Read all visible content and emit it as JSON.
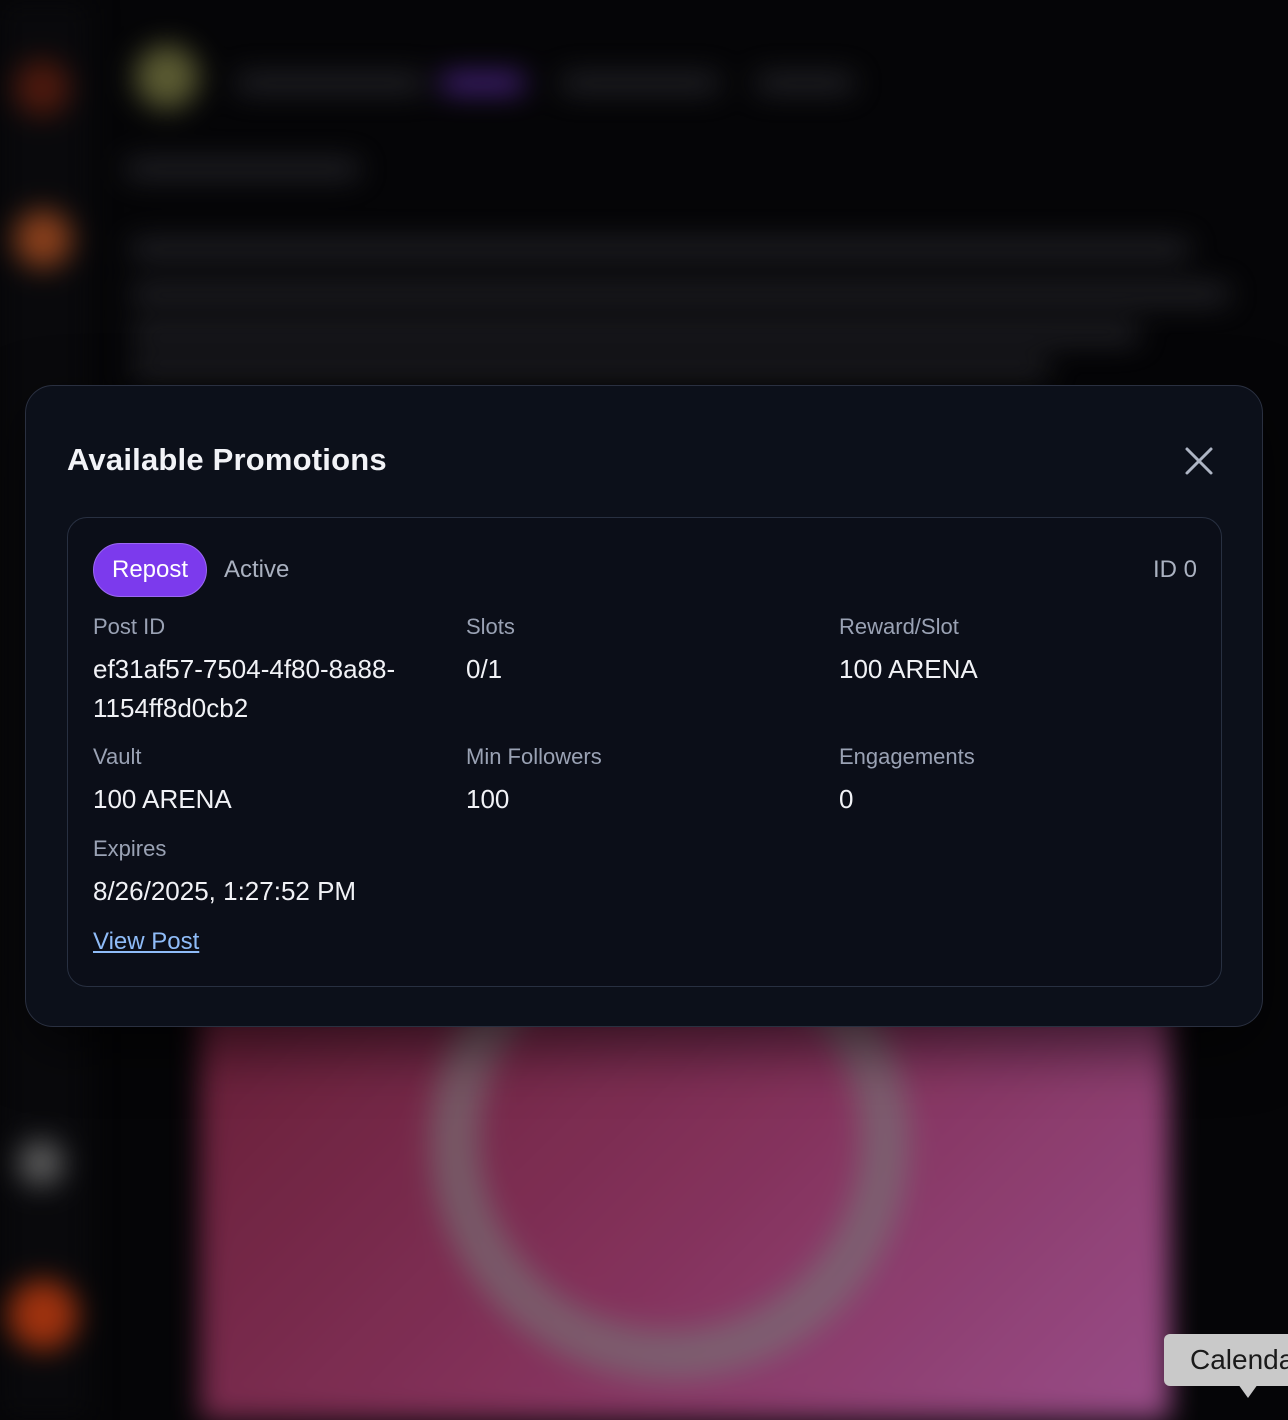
{
  "modal": {
    "title": "Available Promotions",
    "close_icon": "close-icon"
  },
  "promotion": {
    "type_badge": "Repost",
    "status": "Active",
    "id_label": "ID 0",
    "fields": {
      "post_id": {
        "label": "Post ID",
        "value": "ef31af57-7504-4f80-8a88-1154ff8d0cb2"
      },
      "slots": {
        "label": "Slots",
        "value": "0/1"
      },
      "reward_per_slot": {
        "label": "Reward/Slot",
        "value": "100 ARENA"
      },
      "vault": {
        "label": "Vault",
        "value": "100 ARENA"
      },
      "min_followers": {
        "label": "Min Followers",
        "value": "100"
      },
      "engagements": {
        "label": "Engagements",
        "value": "0"
      },
      "expires": {
        "label": "Expires",
        "value": "8/26/2025, 1:27:52 PM"
      }
    },
    "view_post_link": "View Post"
  },
  "tooltip": {
    "text": "Calenda"
  },
  "colors": {
    "accent": "#7c3aed",
    "link": "#8fbcf8",
    "modal_bg": "#0c101a"
  }
}
